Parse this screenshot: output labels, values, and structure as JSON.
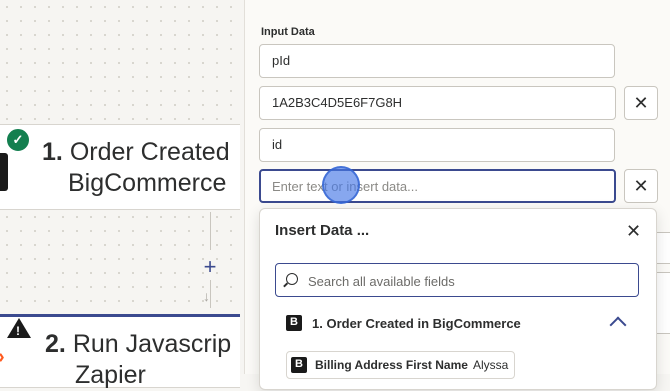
{
  "canvas": {
    "step1": {
      "number": "1.",
      "title_line1": "Order Created",
      "title_line2": "BigCommerce"
    },
    "step2": {
      "number": "2.",
      "title_line1": "Run Javascrip",
      "title_line2": "Zapier"
    },
    "add_step_label": "+"
  },
  "panel": {
    "section_label": "Input Data",
    "fields": [
      {
        "value": "pId"
      },
      {
        "value": "1A2B3C4D5E6F7G8H"
      },
      {
        "value": "id"
      },
      {
        "value": "",
        "placeholder": "Enter text or insert data..."
      }
    ],
    "clear_glyph": "✕"
  },
  "insert_data": {
    "title": "Insert Data ...",
    "close_glyph": "✕",
    "search_placeholder": "Search all available fields",
    "group": {
      "label": "1. Order Created in BigCommerce"
    },
    "items": [
      {
        "name": "Billing Address First Name",
        "value": "Alyssa"
      }
    ]
  },
  "colors": {
    "accent": "#3b4a8f",
    "success": "#137f4f",
    "cursor_highlight": "#4678e6",
    "zapier_orange": "#ff5a1f"
  },
  "icons": [
    "check-icon",
    "warning-icon",
    "bigcommerce-icon",
    "close-icon",
    "search-icon",
    "chevron-up-icon",
    "plus-icon",
    "arrow-down-icon"
  ]
}
